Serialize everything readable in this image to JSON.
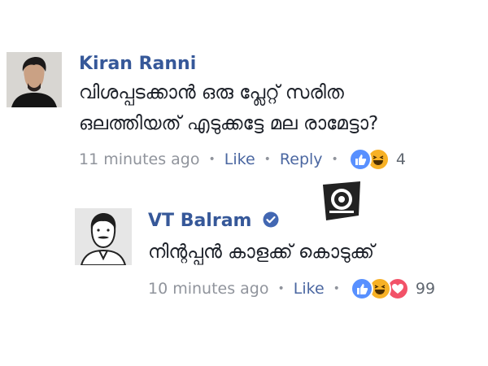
{
  "comments": [
    {
      "author": "Kiran Ranni",
      "line1": "വിശപ്പടക്കാൻ ഒരു പ്ലേറ്റ് സരിത",
      "line2": "ഒലത്തിയത് എടുക്കട്ടേ മല രാമേട്ടാ?",
      "time": "11 minutes ago",
      "like_label": "Like",
      "reply_label": "Reply",
      "reaction_count": "4",
      "reactions": [
        "like-icon",
        "haha-icon"
      ]
    },
    {
      "author": "VT Balram",
      "verified": true,
      "line1": "നിന്റപ്പൻ കാളക്ക് കൊടുക്ക്",
      "time": "10 minutes ago",
      "like_label": "Like",
      "reaction_count": "99",
      "reactions": [
        "like-icon",
        "haha-icon",
        "love-icon"
      ]
    }
  ],
  "colors": {
    "name": "#365899",
    "meta": "#90949c",
    "like_blue": "#5890ff",
    "haha_yellow": "#f7b125",
    "love_red": "#f25268",
    "verified": "#4267b2"
  }
}
